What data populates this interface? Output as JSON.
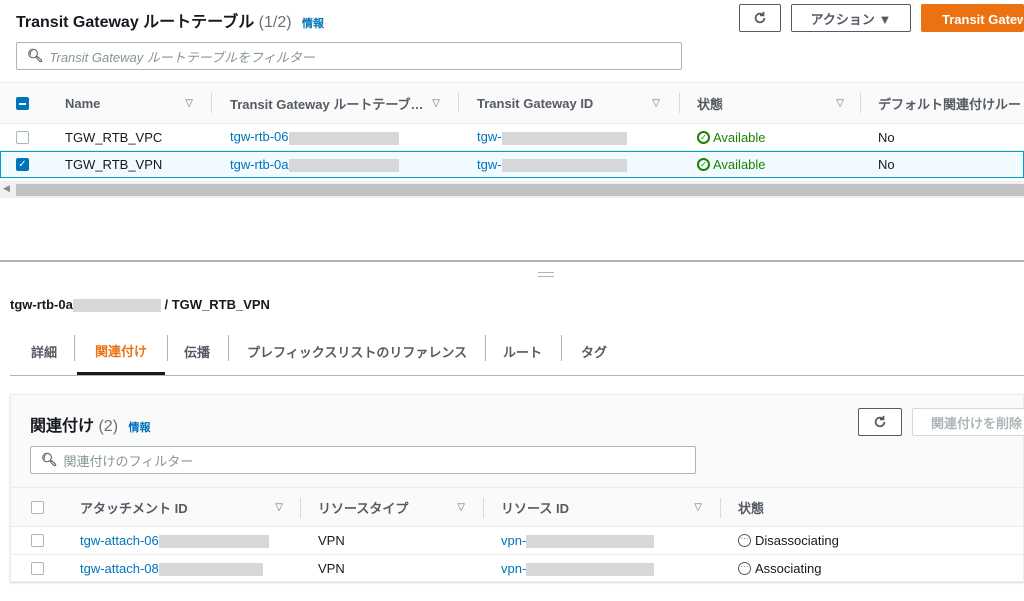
{
  "top": {
    "title": "Transit Gateway ルートテーブル",
    "count": "(1/2)",
    "info": "情報",
    "refresh_icon": "refresh-icon",
    "actions_label": "アクション ▼",
    "create_label": "Transit Gateway ルートテーブルを作成",
    "search_placeholder": "Transit Gateway ルートテーブルをフィルター",
    "columns": [
      "Name",
      "Transit Gateway ルートテーブ…",
      "Transit Gateway ID",
      "状態",
      "デフォルト関連付けルー"
    ],
    "rows": [
      {
        "name": "TGW_RTB_VPC",
        "rtb": "tgw-rtb-06",
        "tgw": "tgw-",
        "state": "Available",
        "default": "No",
        "selected": false
      },
      {
        "name": "TGW_RTB_VPN",
        "rtb": "tgw-rtb-0a",
        "tgw": "tgw-",
        "state": "Available",
        "default": "No",
        "selected": true
      }
    ]
  },
  "detail": {
    "id_prefix": "tgw-rtb-0a",
    "name_suffix": "/ TGW_RTB_VPN",
    "tabs": [
      "詳細",
      "関連付け",
      "伝播",
      "プレフィックスリストのリファレンス",
      "ルート",
      "タグ"
    ],
    "active_tab": "関連付け"
  },
  "assoc": {
    "title": "関連付け",
    "count": "(2)",
    "info": "情報",
    "delete_label": "関連付けを削除",
    "search_placeholder": "関連付けのフィルター",
    "columns": [
      "アタッチメント ID",
      "リソースタイプ",
      "リソース ID",
      "状態"
    ],
    "rows": [
      {
        "attach": "tgw-attach-06",
        "type": "VPN",
        "resource": "vpn-",
        "state": "Disassociating"
      },
      {
        "attach": "tgw-attach-08",
        "type": "VPN",
        "resource": "vpn-",
        "state": "Associating"
      }
    ]
  }
}
